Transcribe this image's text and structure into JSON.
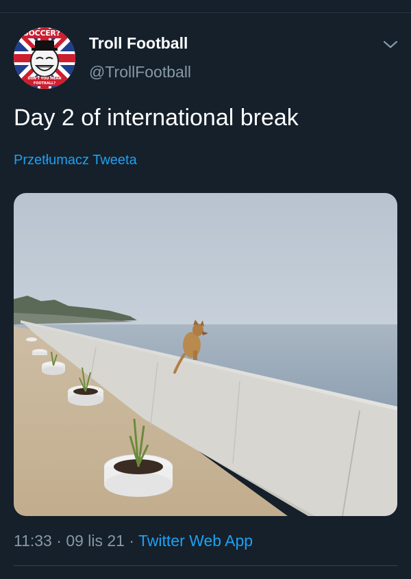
{
  "tweet": {
    "author": {
      "display_name": "Troll Football",
      "handle": "@TrollFootball",
      "avatar_text_top": "SOCCER?",
      "avatar_text_bottom": "DON'T YOU MEAN FOOTBALL?"
    },
    "text": "Day 2 of international break",
    "translate_label": "Przetłumacz Tweeta",
    "time": "11:33",
    "separator": "·",
    "date": "09 lis 21",
    "source_app": "Twitter Web App"
  },
  "icons": {
    "menu": "chevron-down-icon"
  },
  "colors": {
    "background": "#15202b",
    "primary_text": "#ffffff",
    "secondary_text": "#8899a6",
    "link": "#1da1f2",
    "divider": "#38444d"
  }
}
